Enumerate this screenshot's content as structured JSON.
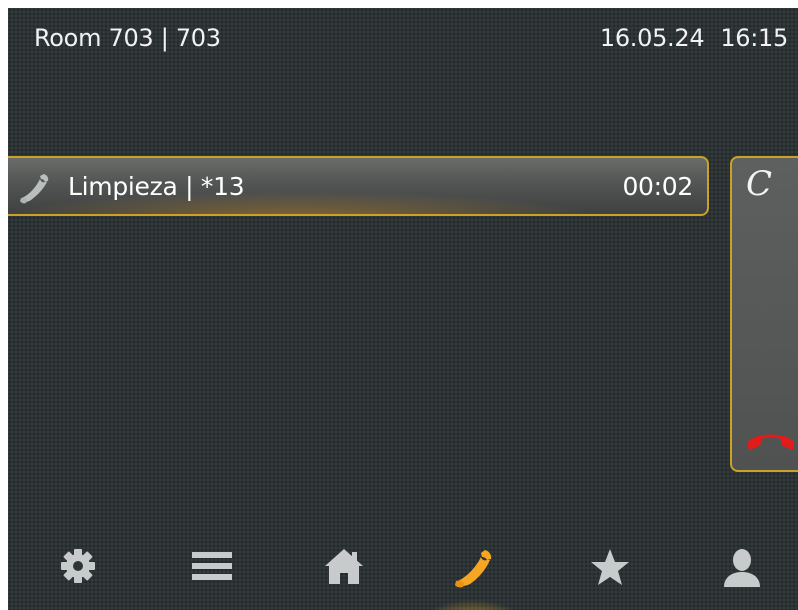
{
  "status_bar": {
    "room": "Room 703 | 703",
    "date": "16.05.24",
    "time": "16:15"
  },
  "active_call": {
    "icon": "phone-handset-icon",
    "name": "Limpieza | *13",
    "duration": "00:02"
  },
  "side_panel": {
    "letter": "C",
    "hangup_icon": "hangup-icon"
  },
  "nav": {
    "items": [
      {
        "icon": "gear-icon",
        "active": false
      },
      {
        "icon": "menu-icon",
        "active": false
      },
      {
        "icon": "home-icon",
        "active": false
      },
      {
        "icon": "phone-icon",
        "active": true
      },
      {
        "icon": "star-icon",
        "active": false
      },
      {
        "icon": "contact-icon",
        "active": false
      }
    ]
  },
  "colors": {
    "accent": "#c9a227",
    "active_icon": "#f5a623",
    "hangup": "#e21b1b",
    "inactive_icon": "#c8cbcb"
  }
}
